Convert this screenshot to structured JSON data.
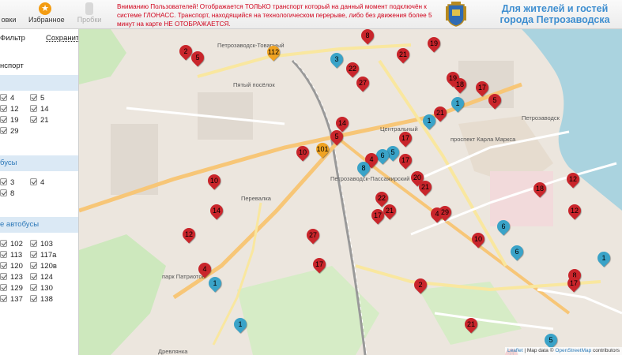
{
  "header": {
    "stops_label": "овки",
    "favorites_label": "Избранное",
    "traffic_label": "Пробки",
    "notice": "Вниманию Пользователей! Отображается ТОЛЬКО транспорт который на данный момент подключён к системе ГЛОНАСС. Транспорт, находящийся на технологическом перерыве, либо без движения более 5 минут на карте НЕ ОТОБРАЖАЕТСЯ.",
    "city_title": "Для жителей и гостей города Петрозаводска"
  },
  "sidebar": {
    "filter_label": "Фильтр",
    "save_label": "Сохранить",
    "transport_label": "нспорт",
    "sections": [
      {
        "title": "",
        "routes": [
          "4",
          "5",
          "12",
          "14",
          "19",
          "21",
          "29"
        ]
      },
      {
        "title": "бусы",
        "routes": [
          "3",
          "4",
          "8"
        ]
      },
      {
        "title": "е автобусы",
        "routes": [
          "102",
          "103",
          "113",
          "117а",
          "120",
          "120в",
          "123",
          "124",
          "129",
          "130",
          "137",
          "138"
        ]
      }
    ]
  },
  "map": {
    "labels": {
      "tovarnaya": "Петрозаводск-Товарный",
      "pyaty": "Пятый посёлок",
      "perevalka": "Перевалка",
      "central": "Центральный",
      "passazhirsky": "Петрозаводск-Пассажирский",
      "petrozavodsk": "Петрозаводск",
      "karla_marksa": "проспект Карла Маркса",
      "drevlyanka": "Древлянка",
      "park": "парк Патриотов"
    },
    "markers": [
      {
        "n": "8",
        "c": "red"
      },
      {
        "n": "2",
        "c": "red"
      },
      {
        "n": "5",
        "c": "red"
      },
      {
        "n": "112",
        "c": "orange"
      },
      {
        "n": "3",
        "c": "blue"
      },
      {
        "n": "22",
        "c": "red"
      },
      {
        "n": "21",
        "c": "red"
      },
      {
        "n": "19",
        "c": "red"
      },
      {
        "n": "19",
        "c": "red"
      },
      {
        "n": "18",
        "c": "red"
      },
      {
        "n": "17",
        "c": "red"
      },
      {
        "n": "27",
        "c": "red"
      },
      {
        "n": "5",
        "c": "red"
      },
      {
        "n": "1",
        "c": "blue"
      },
      {
        "n": "21",
        "c": "red"
      },
      {
        "n": "1",
        "c": "blue"
      },
      {
        "n": "14",
        "c": "red"
      },
      {
        "n": "5",
        "c": "red"
      },
      {
        "n": "17",
        "c": "red"
      },
      {
        "n": "10",
        "c": "red"
      },
      {
        "n": "101",
        "c": "orange"
      },
      {
        "n": "5",
        "c": "blue"
      },
      {
        "n": "17",
        "c": "red"
      },
      {
        "n": "6",
        "c": "blue"
      },
      {
        "n": "4",
        "c": "red"
      },
      {
        "n": "8",
        "c": "blue"
      },
      {
        "n": "10",
        "c": "red"
      },
      {
        "n": "20",
        "c": "red"
      },
      {
        "n": "21",
        "c": "red"
      },
      {
        "n": "12",
        "c": "red"
      },
      {
        "n": "18",
        "c": "red"
      },
      {
        "n": "12",
        "c": "red"
      },
      {
        "n": "22",
        "c": "red"
      },
      {
        "n": "14",
        "c": "red"
      },
      {
        "n": "21",
        "c": "red"
      },
      {
        "n": "17",
        "c": "red"
      },
      {
        "n": "4",
        "c": "red"
      },
      {
        "n": "29",
        "c": "red"
      },
      {
        "n": "12",
        "c": "red"
      },
      {
        "n": "27",
        "c": "red"
      },
      {
        "n": "6",
        "c": "blue"
      },
      {
        "n": "10",
        "c": "red"
      },
      {
        "n": "6",
        "c": "blue"
      },
      {
        "n": "1",
        "c": "blue"
      },
      {
        "n": "17",
        "c": "red"
      },
      {
        "n": "4",
        "c": "red"
      },
      {
        "n": "1",
        "c": "blue"
      },
      {
        "n": "2",
        "c": "red"
      },
      {
        "n": "8",
        "c": "red"
      },
      {
        "n": "17",
        "c": "red"
      },
      {
        "n": "1",
        "c": "blue"
      },
      {
        "n": "21",
        "c": "red"
      },
      {
        "n": "5",
        "c": "blue"
      },
      {
        "n": "21",
        "c": "red"
      }
    ],
    "attribution_leaflet": "Leaflet",
    "attribution_text": " | Map data © ",
    "attribution_osm": "OpenStreetMap",
    "attribution_tail": " contributors"
  },
  "colors": {
    "marker_red": "#c9252b",
    "marker_blue": "#3aa3c8",
    "marker_orange": "#f0a322",
    "notice": "#d0021b",
    "title": "#3e8ed0"
  }
}
